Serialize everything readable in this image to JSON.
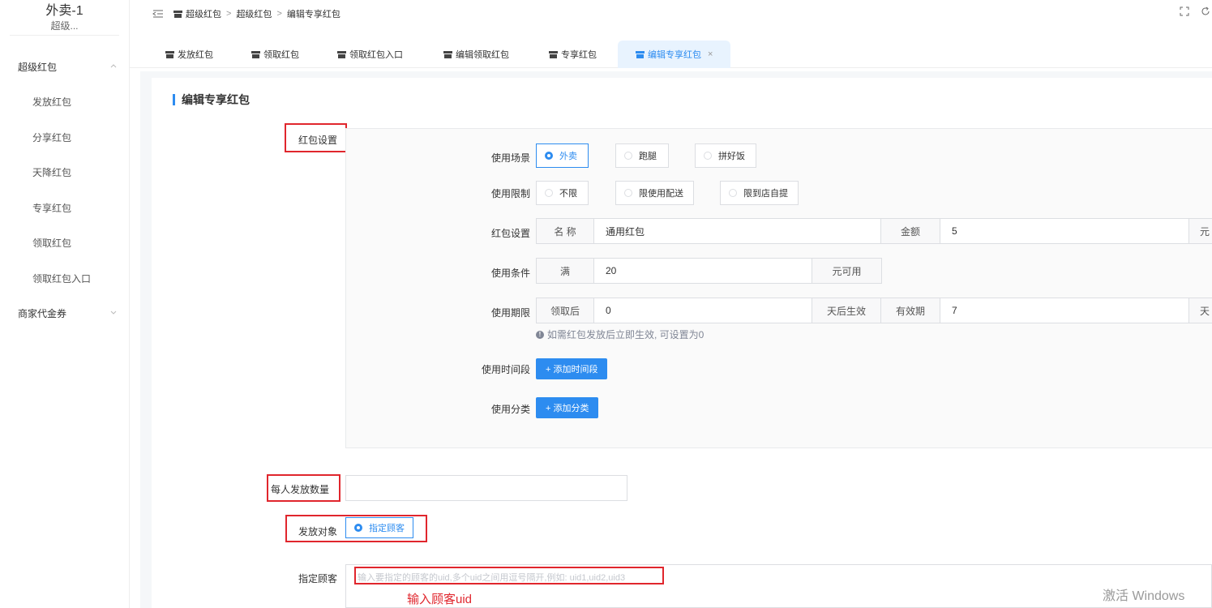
{
  "sidebar": {
    "brand_title": "外卖-1",
    "brand_sub": "超级...",
    "group_super": "超级红包",
    "items": [
      "发放红包",
      "分享红包",
      "天降红包",
      "专享红包",
      "领取红包",
      "领取红包入口"
    ],
    "group_merchant": "商家代金券"
  },
  "breadcrumb": [
    "超级红包",
    "超级红包",
    "编辑专享红包"
  ],
  "tabs": [
    "发放红包",
    "领取红包",
    "领取红包入口",
    "编辑领取红包",
    "专享红包",
    "编辑专享红包"
  ],
  "tab_close": "×",
  "page_title": "编辑专享红包",
  "sections": {
    "redpacket_settings": "红包设置",
    "per_person_count": "每人发放数量",
    "target": "发放对象",
    "target_option": "指定顾客",
    "specified_customer": "指定顾客",
    "customer_placeholder": "输入要指定的顾客的uid,多个uid之间用逗号隔开,例如: uid1,uid2,uid3",
    "annotation": "输入顾客uid"
  },
  "form": {
    "scene_label": "使用场景",
    "scene_options": [
      "外卖",
      "跑腿",
      "拼好饭"
    ],
    "limit_label": "使用限制",
    "limit_options": [
      "不限",
      "限使用配送",
      "限到店自提"
    ],
    "settings_label": "红包设置",
    "name_addon": "名 称",
    "name_value": "通用红包",
    "amount_addon": "金额",
    "amount_value": "5",
    "amount_unit": "元",
    "condition_label": "使用条件",
    "condition_prefix": "满",
    "condition_value": "20",
    "condition_suffix": "元可用",
    "period_label": "使用期限",
    "period_prefix": "领取后",
    "period_value": "0",
    "period_suffix": "天后生效",
    "validity_addon": "有效期",
    "validity_value": "7",
    "validity_unit": "天",
    "period_hint": "如需红包发放后立即生效, 可设置为0",
    "timeslot_label": "使用时间段",
    "timeslot_button": "+ 添加时间段",
    "category_label": "使用分类",
    "category_button": "+ 添加分类"
  },
  "watermark": "激活 Windows",
  "colors": {
    "primary": "#2d8cf0",
    "annotation_red": "#e0262d"
  }
}
